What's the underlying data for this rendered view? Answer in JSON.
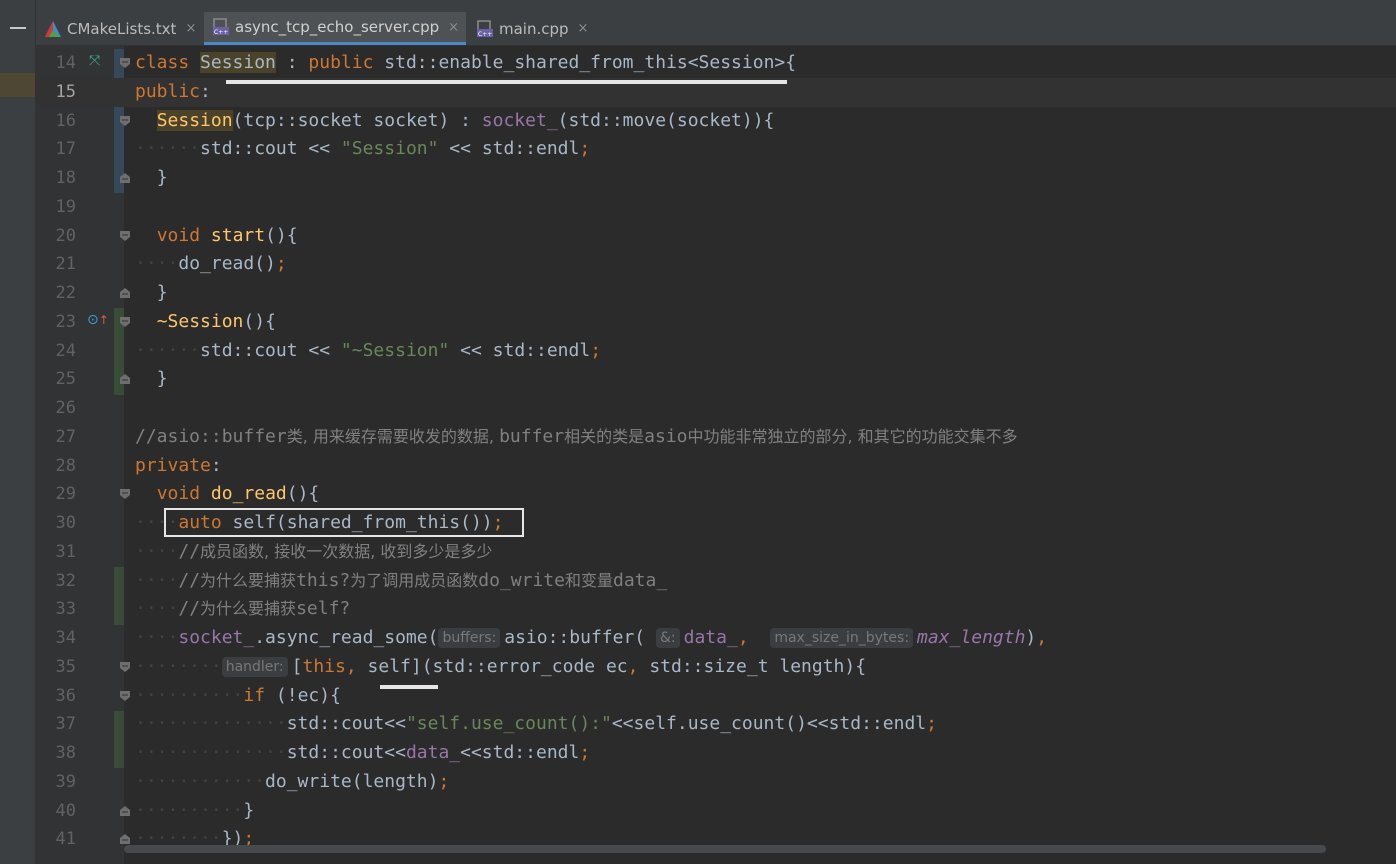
{
  "tabs": [
    {
      "label": "CMakeLists.txt",
      "icon": "cmake-icon",
      "active": false
    },
    {
      "label": "async_tcp_echo_server.cpp",
      "icon": "cpp-file-icon",
      "active": true
    },
    {
      "label": "main.cpp",
      "icon": "cpp-file-icon",
      "active": false
    }
  ],
  "tab_close_glyph": "×",
  "colors": {
    "keyword": "#cc7832",
    "function": "#ffc66d",
    "string": "#6a8759",
    "comment": "#808080",
    "field": "#9876aa",
    "default": "#a9b7c6"
  },
  "editor": {
    "current_line": "15",
    "lines": [
      {
        "n": "14"
      },
      {
        "n": "15"
      },
      {
        "n": "16"
      },
      {
        "n": "17"
      },
      {
        "n": "18"
      },
      {
        "n": "19"
      },
      {
        "n": "20"
      },
      {
        "n": "21"
      },
      {
        "n": "22"
      },
      {
        "n": "23"
      },
      {
        "n": "24"
      },
      {
        "n": "25"
      },
      {
        "n": "26"
      },
      {
        "n": "27"
      },
      {
        "n": "28"
      },
      {
        "n": "29"
      },
      {
        "n": "30"
      },
      {
        "n": "31"
      },
      {
        "n": "32"
      },
      {
        "n": "33"
      },
      {
        "n": "34"
      },
      {
        "n": "35"
      },
      {
        "n": "36"
      },
      {
        "n": "37"
      },
      {
        "n": "38"
      },
      {
        "n": "39"
      },
      {
        "n": "40"
      },
      {
        "n": "41"
      }
    ],
    "code": {
      "l14": {
        "kw1": "class",
        "name": "Session",
        "colon": " : ",
        "kw2": "public",
        "rest": " std::enable_shared_from_this<Session>{"
      },
      "l15": {
        "kw": "public",
        "rest": ":"
      },
      "l16": {
        "fn": "Session",
        "a": "(tcp::socket socket) : ",
        "fld": "socket_",
        "b": "(std::move(socket)){"
      },
      "l17": {
        "a": "std::cout << ",
        "str": "\"Session\"",
        "b": " << std::endl",
        "semi": ";"
      },
      "l18": {
        "a": "}"
      },
      "l20": {
        "kw": "void",
        "fn": "start",
        "a": "(){"
      },
      "l21": {
        "a": "do_read()",
        "semi": ";"
      },
      "l22": {
        "a": "}"
      },
      "l23": {
        "fn": "~Session",
        "a": "(){"
      },
      "l24": {
        "a": "std::cout << ",
        "str": "\"~Session\"",
        "b": " << std::endl",
        "semi": ";"
      },
      "l25": {
        "a": "}"
      },
      "l27": {
        "c1": "//asio::buffer",
        "c2": "类, 用来缓存需要收发的数据, ",
        "c3": "buffer",
        "c4": "相关的类是",
        "c5": "asio",
        "c6": "中功能非常独立的部分, 和其它的功能交集不多"
      },
      "l28": {
        "kw": "private",
        "rest": ":"
      },
      "l29": {
        "kw": "void",
        "fn": "do_read",
        "a": "(){"
      },
      "l30": {
        "kw": "auto",
        "a": " self(shared_from_this())",
        "semi": ";"
      },
      "l31": {
        "c1": "//",
        "c2": "成员函数, 接收一次数据, 收到多少是多少"
      },
      "l32": {
        "c1": "//",
        "c2": "为什么要捕获",
        "c3": "this?",
        "c4": "为了调用成员函数",
        "c5": "do_write",
        "c6": "和变量",
        "c7": "data_"
      },
      "l33": {
        "c1": "//",
        "c2": "为什么要捕获",
        "c3": "self?"
      },
      "l34": {
        "fld": "socket_",
        "a": ".async_read_some(",
        "hint1": "buffers:",
        "b": "asio::buffer(",
        "hint2": "&:",
        "fld2": "data_",
        "comma": ",",
        "hint3": "max_size_in_bytes:",
        "ital": "max_length",
        "c": ")",
        "comma2": ","
      },
      "l35": {
        "hint": "handler:",
        "a": "[",
        "kw": "this",
        "comma": ",",
        "b": " self](std::error_code ec",
        "comma2": ",",
        "c": " std::size_t length){"
      },
      "l36": {
        "kw": "if",
        "a": " (!ec){"
      },
      "l37": {
        "a": "std::cout<<",
        "str": "\"self.use_count():\"",
        "b": "<<self.use_count()<<std::endl",
        "semi": ";"
      },
      "l38": {
        "a": "std::cout<<",
        "fld": "data_",
        "b": "<<std::endl",
        "semi": ";"
      },
      "l39": {
        "a": "do_write(length)",
        "semi": ";"
      },
      "l40": {
        "a": "}"
      },
      "l41": {
        "a": "})",
        "semi": ";"
      }
    }
  }
}
